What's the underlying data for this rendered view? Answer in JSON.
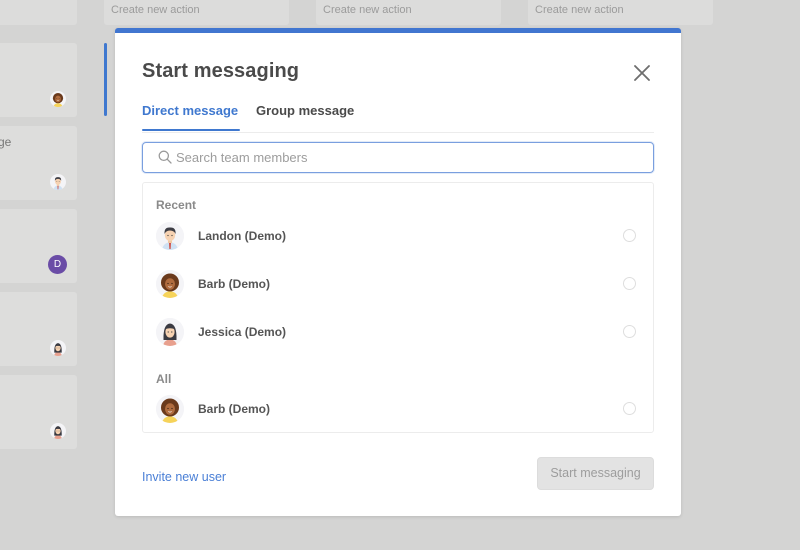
{
  "background": {
    "top_actions": [
      {
        "label": "Create new action"
      },
      {
        "label": "Create new action"
      },
      {
        "label": "Create new action"
      }
    ],
    "left_cards": [
      {
        "snippet": "",
        "avatar": "barb-avatar"
      },
      {
        "snippet": "ge",
        "avatar": "landon-avatar"
      },
      {
        "snippet": "",
        "avatar": "initial-badge",
        "initial": "D"
      },
      {
        "snippet": "",
        "avatar": "jessica-avatar"
      },
      {
        "snippet": "",
        "avatar": "jessica-avatar"
      }
    ]
  },
  "modal": {
    "title": "Start messaging",
    "close_icon": "close-icon",
    "accent_color": "#4176d0",
    "tabs": [
      {
        "label": "Direct message",
        "active": true
      },
      {
        "label": "Group message",
        "active": false
      }
    ],
    "search": {
      "placeholder": "Search team members",
      "value": "",
      "icon": "search-icon"
    },
    "sections": [
      {
        "label": "Recent",
        "members": [
          {
            "name": "Landon (Demo)",
            "avatar": "landon-avatar",
            "selected": false
          },
          {
            "name": "Barb (Demo)",
            "avatar": "barb-avatar",
            "selected": false
          },
          {
            "name": "Jessica (Demo)",
            "avatar": "jessica-avatar",
            "selected": false
          }
        ]
      },
      {
        "label": "All",
        "members": [
          {
            "name": "Barb (Demo)",
            "avatar": "barb-avatar",
            "selected": false
          }
        ]
      }
    ],
    "footer": {
      "invite_label": "Invite new user",
      "start_label": "Start messaging",
      "start_disabled": true
    }
  }
}
